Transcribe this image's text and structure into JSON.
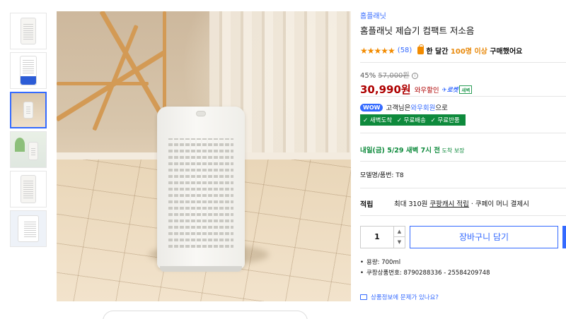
{
  "breadcrumb": "",
  "product": {
    "brand": "홈플래닛",
    "title": "홈플래닛 제습기 컴팩트 저소음",
    "stars": "★★★★★",
    "review_count": "(58)",
    "purchase_prefix": "한 달간 ",
    "purchase_highlight": "100명 이상",
    "purchase_suffix": " 구매했어요"
  },
  "price": {
    "discount_rate": "45%",
    "original_price": "57,000원",
    "info_icon": "i",
    "sale_price": "30,990원",
    "wow_sale_label": "와우할인",
    "rocket_label": "✈로켓",
    "rocket_dawn_label": "새벽"
  },
  "wow": {
    "badge": "WOW",
    "text_prefix": "고객님은 ",
    "link": "와우회원",
    "text_suffix": "으로"
  },
  "benefits": [
    "✓ 새벽도착",
    "✓ 무료배송",
    "✓ 무료반품"
  ],
  "delivery": {
    "text": "내일(금) 5/29 새벽 7시 전",
    "note": " 도착 보장"
  },
  "model": "모델명/품번: T8",
  "accumulate": {
    "label": "적립",
    "prefix": "최대 310원 ",
    "link": "쿠팡캐시 적립",
    "suffix": " · 쿠페이 머니 결제시"
  },
  "quantity": {
    "value": "1",
    "up": "▲",
    "down": "▼"
  },
  "cart_button": "장바구니 담기",
  "specs": [
    "용량: 700ml",
    "쿠팡상품번호: 8790288336 - 25584209748"
  ],
  "report_link": "상품정보에 문제가 있나요?",
  "icons": {
    "star": "star-icon",
    "bag": "shopping-bag-icon",
    "info": "info-icon",
    "report": "report-icon"
  },
  "colors": {
    "accent": "#346aff",
    "sale": "#ae0000",
    "green": "#0e8a3c",
    "star": "#f28b00"
  }
}
